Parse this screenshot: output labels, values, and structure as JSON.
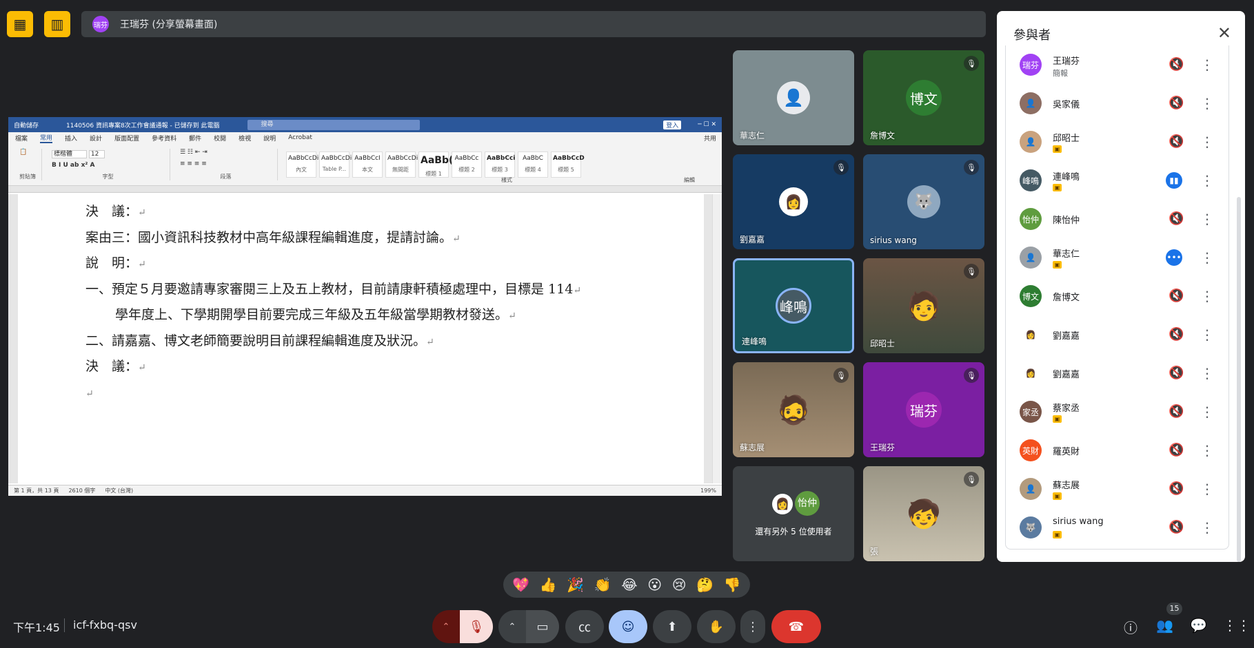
{
  "presenter": {
    "avatar": "瑞芬",
    "label": "王瑞芬 (分享螢幕畫面)"
  },
  "word": {
    "title": "1140506 資訊專案8次工作會議通報 - 已儲存到 此電腦",
    "autosave": "自動儲存",
    "search": "搜尋",
    "login": "登入",
    "share": "共用",
    "tabs": [
      "檔案",
      "常用",
      "插入",
      "設計",
      "版面配置",
      "參考資料",
      "郵件",
      "校閱",
      "檢視",
      "說明",
      "Acrobat"
    ],
    "font": "標楷體",
    "font_size": "12",
    "styles": [
      {
        "preview": "AaBbCcDi",
        "name": "內文"
      },
      {
        "preview": "AaBbCcDi",
        "name": "Table P..."
      },
      {
        "preview": "AaBbCcI",
        "name": "本文"
      },
      {
        "preview": "AaBbCcDi",
        "name": "無間距"
      },
      {
        "preview": "AaBb(",
        "name": "標題 1"
      },
      {
        "preview": "AaBbCc",
        "name": "標題 2"
      },
      {
        "preview": "AaBbCci",
        "name": "標題 3"
      },
      {
        "preview": "AaBbC",
        "name": "標題 4"
      },
      {
        "preview": "AaBbCcD",
        "name": "標題 5"
      }
    ],
    "group_labels": [
      "剪貼簿",
      "字型",
      "段落",
      "樣式",
      "編輯"
    ],
    "doc_lines": [
      "決　議：",
      "案由三：國小資訊科技教材中高年級課程編輯進度，提請討論。",
      "說　明：",
      "一、預定５月要邀請專家審閱三上及五上教材，目前請康軒積極處理中，目標是 114",
      "學年度上、下學期開學目前要完成三年級及五年級當學期教材發送。",
      "二、請嘉嘉、博文老師簡要說明目前課程編輯進度及狀況。",
      "決　議：",
      ""
    ],
    "status": {
      "page": "第 1 頁，共 13 頁",
      "words": "2610 個字",
      "lang": "中文 (台灣)",
      "zoom": "199%"
    }
  },
  "tiles": [
    {
      "name": "華志仁",
      "avatar": "",
      "muted": false,
      "bg": "#7d8c90"
    },
    {
      "name": "詹博文",
      "avatar": "博文",
      "muted": true,
      "bg": "#2b5a2b"
    },
    {
      "name": "劉嘉嘉",
      "avatar": "",
      "muted": true,
      "bg": "#163b63"
    },
    {
      "name": "sirius wang",
      "avatar": "",
      "muted": true,
      "bg": "#284d73"
    },
    {
      "name": "連峰鳴",
      "avatar": "峰鳴",
      "muted": false,
      "bg": "#17565d"
    },
    {
      "name": "邱昭士",
      "avatar": "",
      "muted": true,
      "bg": "#5e4a3a"
    },
    {
      "name": "蘇志展",
      "avatar": "",
      "muted": true,
      "bg": "#6b5a4a"
    },
    {
      "name": "王瑞芬",
      "avatar": "瑞芬",
      "muted": true,
      "bg": "#7b1fa2"
    },
    {
      "name": "還有另外 5 位使用者",
      "avatar": "怡仲",
      "muted": false,
      "bg": "#3c4043"
    },
    {
      "name": "張",
      "avatar": "",
      "muted": true,
      "bg": "#8a8575"
    }
  ],
  "participants_panel": {
    "title": "參與者",
    "list": [
      {
        "name": "王瑞芬",
        "sub": "簡報",
        "avatar": "瑞芬",
        "color": "#a142f4",
        "mic": "muted"
      },
      {
        "name": "吳家儀",
        "sub": "",
        "avatar": "",
        "color": "#8d6e63",
        "mic": "muted"
      },
      {
        "name": "邱昭士",
        "sub": "tag",
        "avatar": "",
        "color": "#c9a27e",
        "mic": "muted"
      },
      {
        "name": "連峰鳴",
        "sub": "tag",
        "avatar": "峰鳴",
        "color": "#455a64",
        "mic": "speaking"
      },
      {
        "name": "陳怡仲",
        "sub": "",
        "avatar": "怡仲",
        "color": "#5f9c3f",
        "mic": "muted"
      },
      {
        "name": "華志仁",
        "sub": "tag",
        "avatar": "",
        "color": "#9aa0a6",
        "mic": "more"
      },
      {
        "name": "詹博文",
        "sub": "",
        "avatar": "博文",
        "color": "#2e7d32",
        "mic": "muted"
      },
      {
        "name": "劉嘉嘉",
        "sub": "",
        "avatar": "",
        "color": "#ffffff",
        "mic": "muted"
      },
      {
        "name": "劉嘉嘉",
        "sub": "",
        "avatar": "",
        "color": "#ffffff",
        "mic": "muted"
      },
      {
        "name": "蔡家丞",
        "sub": "tag",
        "avatar": "家丞",
        "color": "#795548",
        "mic": "muted"
      },
      {
        "name": "羅英財",
        "sub": "",
        "avatar": "英財",
        "color": "#f4511e",
        "mic": "muted"
      },
      {
        "name": "蘇志展",
        "sub": "tag",
        "avatar": "",
        "color": "#b39b7d",
        "mic": "muted"
      },
      {
        "name": "sirius wang",
        "sub": "tag",
        "avatar": "",
        "color": "#5b7ba0",
        "mic": "muted"
      }
    ]
  },
  "reactions": [
    "💖",
    "👍",
    "🎉",
    "👏",
    "😂",
    "😮",
    "😢",
    "🤔",
    "👎"
  ],
  "footer": {
    "time": "下午1:45",
    "code": "icf-fxbq-qsv",
    "people_count": "15"
  }
}
